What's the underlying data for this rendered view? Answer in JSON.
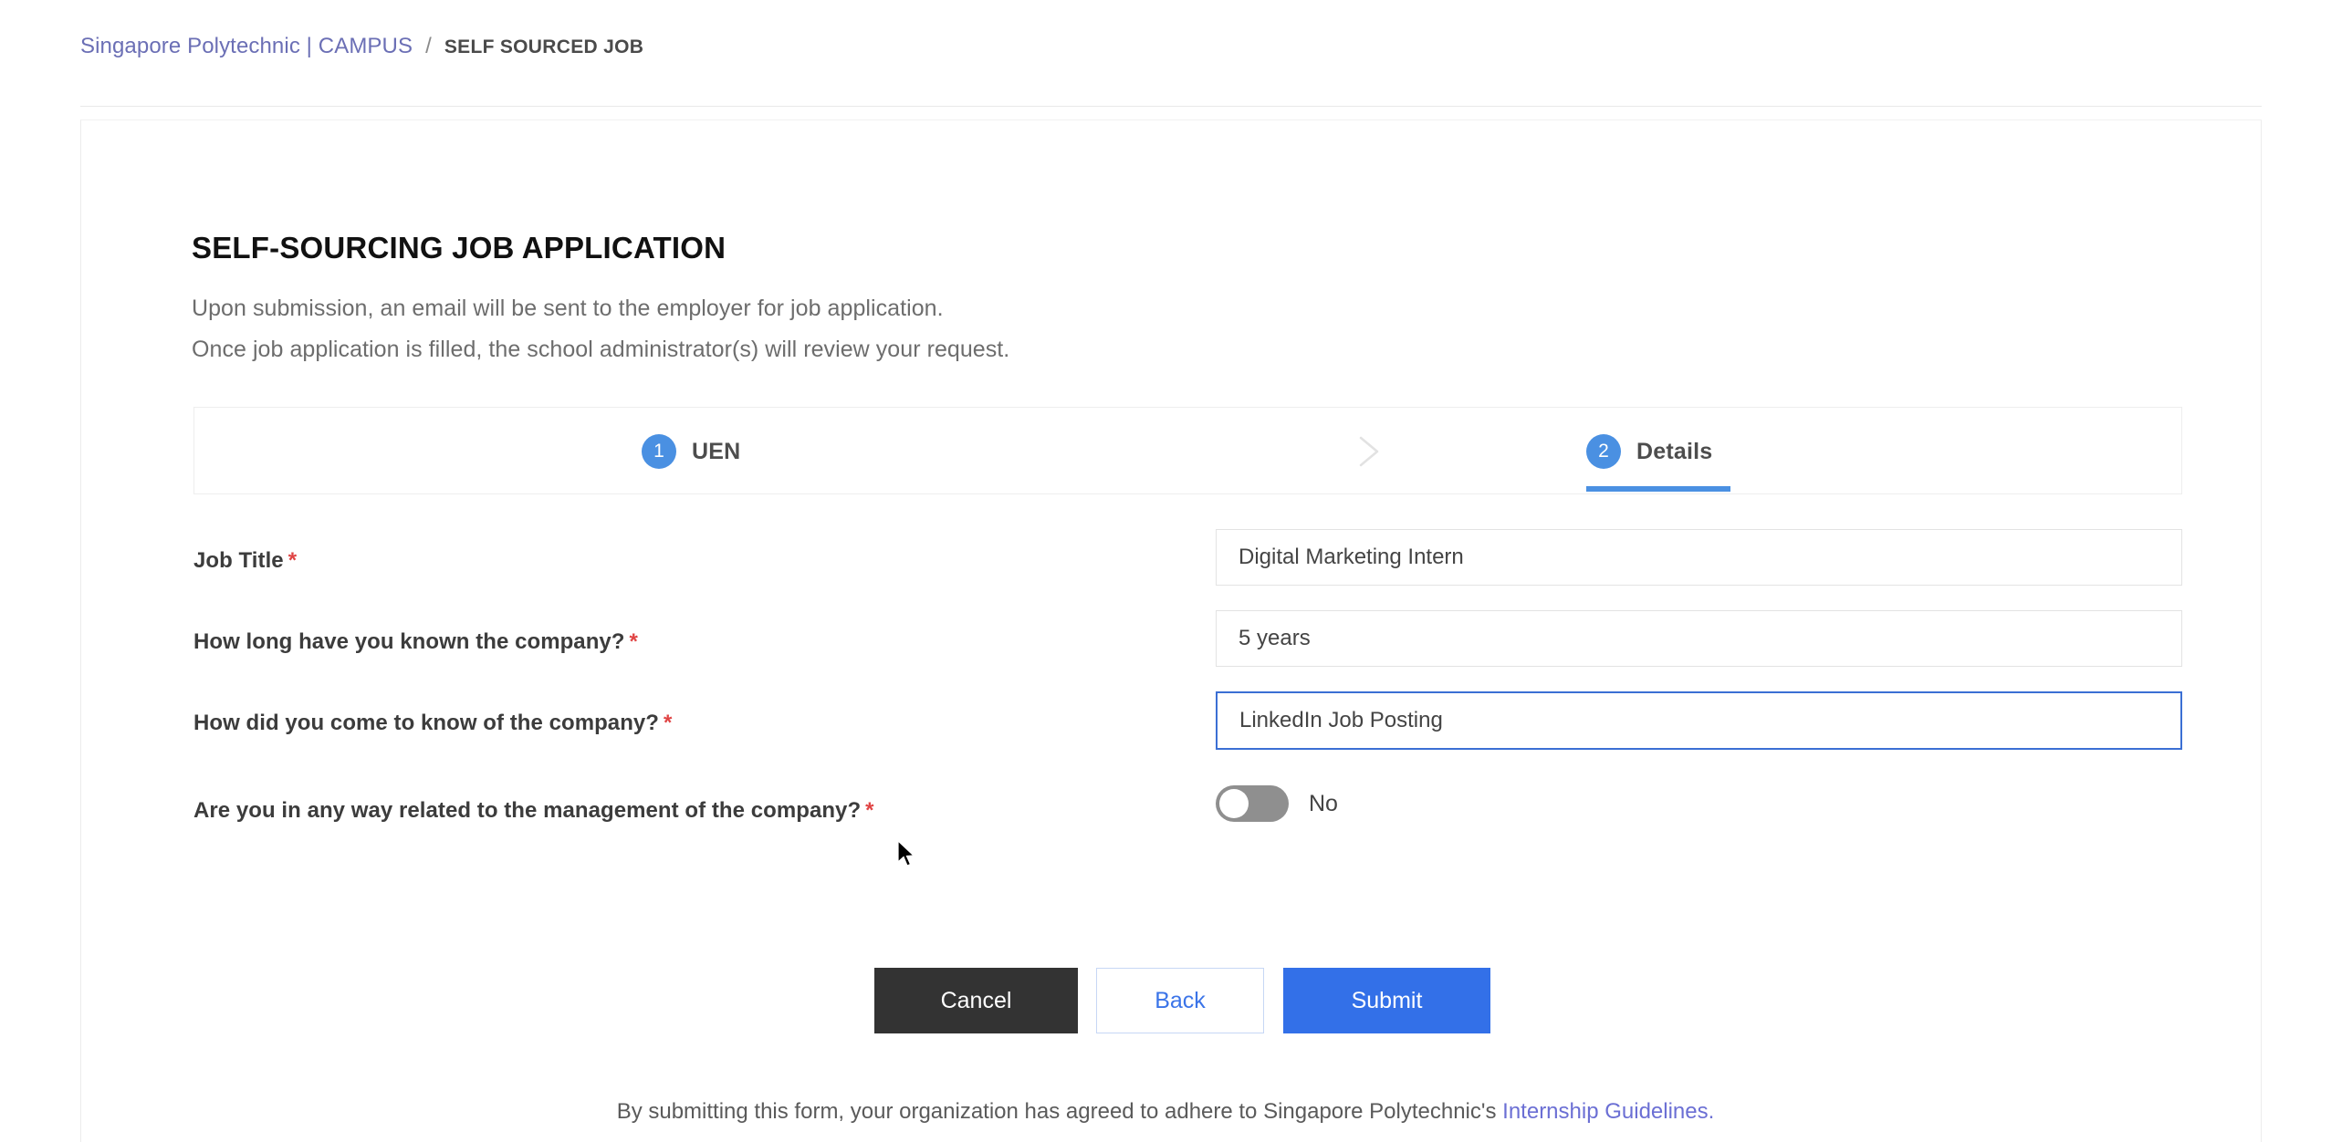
{
  "breadcrumb": {
    "root_label": "Singapore Polytechnic | CAMPUS",
    "separator": "/",
    "current_label": "SELF SOURCED JOB"
  },
  "page": {
    "title": "SELF-SOURCING JOB APPLICATION",
    "intro_line_1": "Upon submission, an email will be sent to the employer for job application.",
    "intro_line_2": "Once job application is filled, the school administrator(s) will review your request."
  },
  "stepper": {
    "steps": [
      {
        "number": "1",
        "label": "UEN",
        "active": false
      },
      {
        "number": "2",
        "label": "Details",
        "active": true
      }
    ],
    "separator_icon": "chevron-right-icon"
  },
  "form": {
    "fields": [
      {
        "label": "Job Title",
        "required_marker": "*",
        "value": "Digital Marketing Intern",
        "placeholder": "",
        "type": "text",
        "focused": false
      },
      {
        "label": "How long have you known the company?",
        "required_marker": "*",
        "value": "5 years",
        "placeholder": "",
        "type": "text",
        "focused": false
      },
      {
        "label": "How did you come to know of the company?",
        "required_marker": "*",
        "value": "LinkedIn Job Posting",
        "placeholder": "",
        "type": "text",
        "focused": true
      },
      {
        "label": "Are you in any way related to the management of the company?",
        "required_marker": "*",
        "value": "No",
        "type": "toggle",
        "toggle_on": false
      }
    ]
  },
  "actions": {
    "cancel_label": "Cancel",
    "back_label": "Back",
    "submit_label": "Submit"
  },
  "footer": {
    "text": "By submitting this form, your organization has agreed to adhere to Singapore Polytechnic's",
    "link_label": "Internship Guidelines."
  },
  "colors": {
    "accent_blue": "#3370e8",
    "step_blue": "#4a90e2",
    "required_red": "#e04444",
    "link_purple": "#6b6fb5",
    "cancel_dark": "#333333"
  }
}
